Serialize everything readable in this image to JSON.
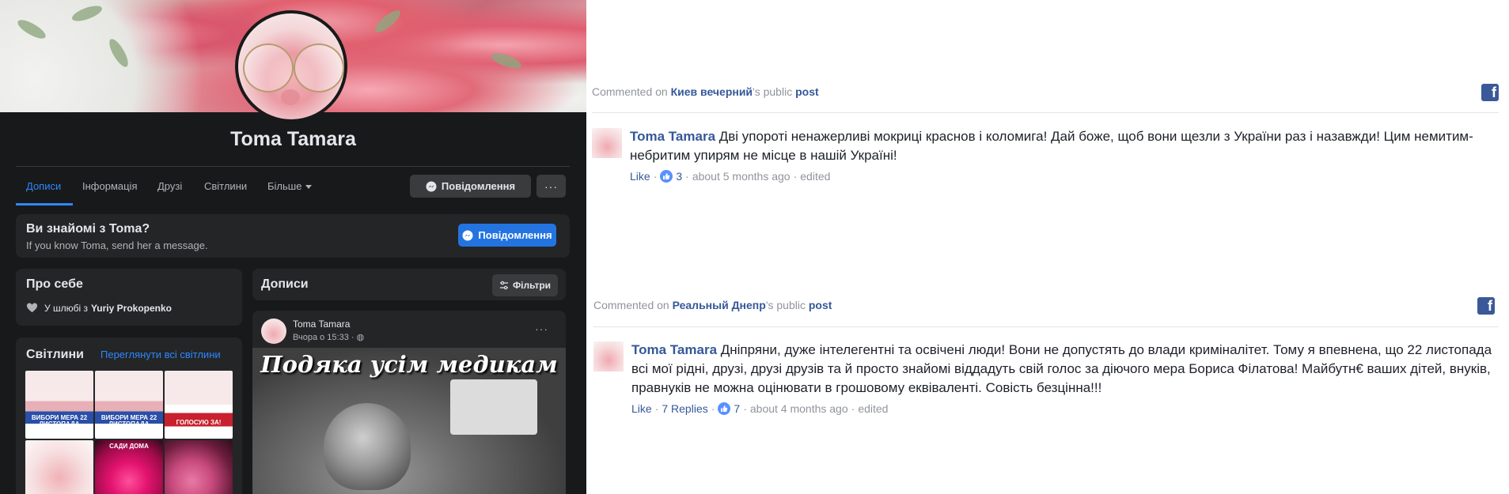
{
  "profile": {
    "name": "Toma Tamara",
    "tabs": [
      "Дописи",
      "Інформація",
      "Друзі",
      "Світлини",
      "Більше"
    ],
    "message_button": "Повідомлення",
    "more_button": "···"
  },
  "know_card": {
    "title": "Ви знайомі з Toma?",
    "subtitle": "If you know Toma, send her a message.",
    "button": "Повідомлення"
  },
  "about": {
    "title": "Про себе",
    "relationship_prefix": "У шлюбі з",
    "relationship_name": "Yuriy Prokopenko"
  },
  "photos": {
    "title": "Світлини",
    "see_all": "Переглянути всі світлини",
    "thumb_labels": [
      "ВИБОРИ МЕРА 22 ЛИСТОПАДА",
      "ВИБОРИ МЕРА 22 ЛИСТОПАДА",
      "ГОЛОСУЮ ЗА!",
      "",
      "САДИ ДОМА",
      ""
    ]
  },
  "posts": {
    "title": "Дописи",
    "filters_button": "Фільтри",
    "post": {
      "author": "Toma Tamara",
      "time": "Вчора о 15:33 · ",
      "image_title": "Подяка усім медикам"
    }
  },
  "comments": [
    {
      "commented_prefix": "Commented on",
      "page": "Киев вечерний",
      "suffix": "'s public",
      "post_link": "post",
      "author": "Toma Tamara",
      "text": " Дві упороті ненажерливі мокриці краснов і коломига! Дай боже, щоб вони щезли з України раз і назавжди! Цим немитим-небритим упирям не місце в нашій Україні!",
      "like": "Like",
      "replies": "",
      "likes_count": "3",
      "time": "about 5 months ago",
      "edited": "edited"
    },
    {
      "commented_prefix": "Commented on",
      "page": "Реальный Днепр",
      "suffix": "'s public",
      "post_link": "post",
      "author": "Toma Tamara",
      "text": " Дніпряни, дуже інтелегентні та освічені люди! Вони не допустять до влади криміналітет. Тому я впевнена, що 22 листопада всі мої рідні, друзі, друзі друзів та й просто знайомі віддадуть свій голос за діючого мера Бориса Філатова! Майбутн€ ваших дітей, внуків, правнуків не можна оцінювати в грошовому еквіваленті. Совість безцінна!!!",
      "like": "Like",
      "replies": "7 Replies",
      "likes_count": "7",
      "time": "about 4 months ago",
      "edited": "edited"
    }
  ],
  "colors": {
    "fb_dark_bg": "#18191a",
    "fb_card": "#242526",
    "fb_blue": "#2d88ff",
    "link_blue": "#365899"
  }
}
